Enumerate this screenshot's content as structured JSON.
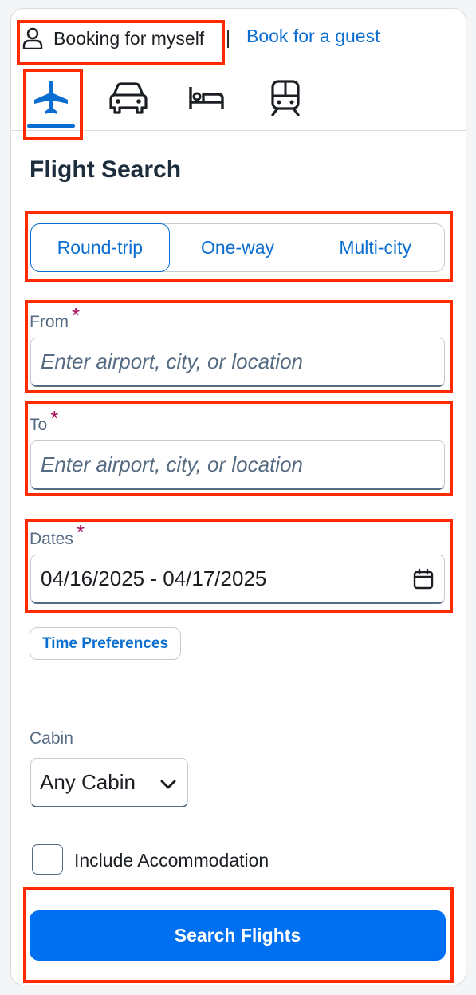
{
  "booking": {
    "self_label": "Booking for myself",
    "separator": "|",
    "guest_label": "Book for a guest"
  },
  "modes": [
    {
      "icon": "airplane-icon",
      "active": true
    },
    {
      "icon": "car-icon",
      "active": false
    },
    {
      "icon": "hotel-bed-icon",
      "active": false
    },
    {
      "icon": "train-icon",
      "active": false
    }
  ],
  "title": "Flight Search",
  "trip_types": {
    "round_trip": "Round-trip",
    "one_way": "One-way",
    "multi_city": "Multi-city",
    "selected": "Round-trip"
  },
  "from": {
    "label": "From",
    "required_mark": "*",
    "placeholder": "Enter airport, city, or location"
  },
  "to": {
    "label": "To",
    "required_mark": "*",
    "placeholder": "Enter airport, city, or location"
  },
  "dates": {
    "label": "Dates",
    "required_mark": "*",
    "value": "04/16/2025 - 04/17/2025"
  },
  "time_preferences": "Time Preferences",
  "cabin": {
    "label": "Cabin",
    "value": "Any Cabin"
  },
  "accommodation": {
    "label": "Include Accommodation",
    "checked": false
  },
  "search_button": "Search Flights",
  "colors": {
    "accent": "#0a6ed1",
    "button": "#0070f2",
    "required": "#aa0a5a",
    "highlight": "#ff2a00"
  }
}
